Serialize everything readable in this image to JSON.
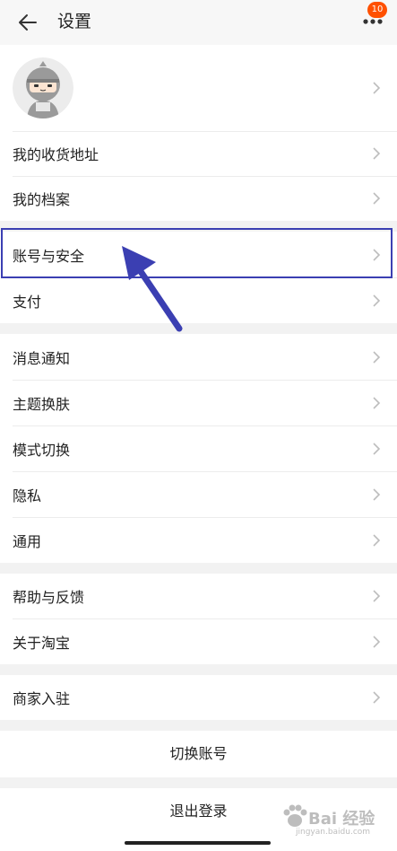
{
  "header": {
    "title": "设置",
    "back_icon": "arrow-left-icon",
    "more_icon": "more-dots-icon",
    "badge_count": "10"
  },
  "profile": {
    "avatar_icon": "ninja-avatar"
  },
  "section1": {
    "items": [
      {
        "label": "我的收货地址"
      },
      {
        "label": "我的档案"
      }
    ]
  },
  "section2": {
    "items": [
      {
        "label": "账号与安全"
      },
      {
        "label": "支付"
      }
    ]
  },
  "section3": {
    "items": [
      {
        "label": "消息通知"
      },
      {
        "label": "主题换肤"
      },
      {
        "label": "模式切换"
      },
      {
        "label": "隐私"
      },
      {
        "label": "通用"
      }
    ]
  },
  "section4": {
    "items": [
      {
        "label": "帮助与反馈"
      },
      {
        "label": "关于淘宝"
      }
    ]
  },
  "section5": {
    "items": [
      {
        "label": "商家入驻"
      }
    ]
  },
  "actions": {
    "switch_account": "切换账号",
    "logout": "退出登录"
  },
  "watermark": {
    "brand": "Bai 经验",
    "url": "jingyan.baidu.com"
  },
  "colors": {
    "badge": "#ff5000",
    "annotation": "#3b3fb2"
  }
}
